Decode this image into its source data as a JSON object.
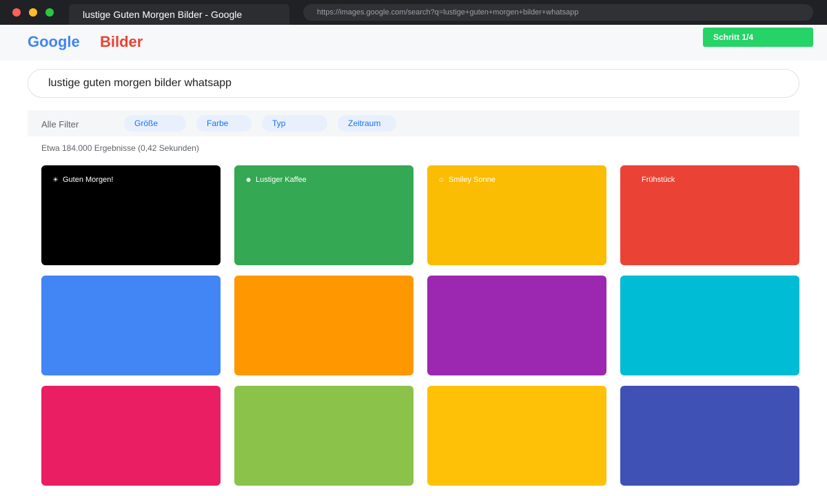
{
  "browser": {
    "tab_title": "lustige Guten Morgen Bilder - Google",
    "url": "https://images.google.com/search?q=lustige+guten+morgen+bilder+whatsapp"
  },
  "header": {
    "logo_google": "Google",
    "logo_bilder": "Bilder",
    "step_badge": "Schritt 1/4"
  },
  "search": {
    "value": "lustige guten morgen bilder whatsapp"
  },
  "filters": {
    "label": "Alle Filter",
    "chips": [
      "Größe",
      "Farbe",
      "Typ",
      "Zeitraum"
    ]
  },
  "results": {
    "stats": "Etwa 184.000 Ergebnisse (0,42 Sekunden)"
  },
  "images": [
    {
      "color": "#000000",
      "caption": "Guten Morgen!",
      "icon": "sun-icon",
      "glyph": "☀"
    },
    {
      "color": "#34a853",
      "caption": "Lustiger Kaffee",
      "icon": "smiley-icon",
      "glyph": "☻"
    },
    {
      "color": "#fbbc04",
      "caption": "Smiley Sonne",
      "icon": "smiley-sun-icon",
      "glyph": "☺"
    },
    {
      "color": "#ea4335",
      "caption": "Frühstück",
      "icon": "breakfast-icon",
      "glyph": ""
    },
    {
      "color": "#4285f4"
    },
    {
      "color": "#ff9800"
    },
    {
      "color": "#9c27b0"
    },
    {
      "color": "#00bcd4"
    },
    {
      "color": "#e91e63"
    },
    {
      "color": "#8bc34a"
    },
    {
      "color": "#ffc107"
    },
    {
      "color": "#3f51b5"
    }
  ]
}
